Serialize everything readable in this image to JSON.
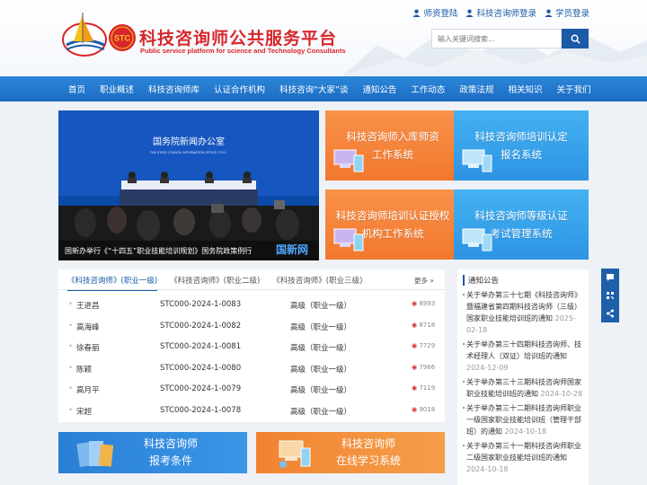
{
  "header": {
    "title": "科技咨询师公共服务平台",
    "subtitle": "Public service platform for science and Technology Consultants",
    "logo_badge": "STC",
    "top_links": [
      "师资登陆",
      "科技咨询师登录",
      "学员登录"
    ],
    "search_placeholder": "输入关键词搜索..."
  },
  "nav": {
    "items": [
      "首页",
      "职业概述",
      "科技咨询师库",
      "认证合作机构",
      "科技咨询“大家”谈",
      "通知公告",
      "工作动态",
      "政策法规",
      "相关知识",
      "关于我们"
    ]
  },
  "banner": {
    "screen_text": "国务院新闻办公室",
    "screen_subtext": "THE STATE COUNCIL INFORMATION OFFICE, P.R.C.",
    "caption": "国新办举行《“十四五”职业技能培训规划》国务院政策例行",
    "watermark": "国新网"
  },
  "tiles": [
    {
      "line1": "科技咨询师入库师资",
      "line2": "工作系统"
    },
    {
      "line1": "科技咨询师培训认定",
      "line2": "报名系统"
    },
    {
      "line1": "科技咨询师培训认证授权",
      "line2": "机构工作系统"
    },
    {
      "line1": "科技咨询师等级认证",
      "line2": "考试管理系统"
    }
  ],
  "consultants": {
    "tabs": [
      "《科技咨询师》(职业一级)",
      "《科技咨询师》(职业二级)",
      "《科技咨询师》(职业三级)"
    ],
    "more": "更多 »",
    "rows": [
      {
        "name": "王进昌",
        "code": "STC000-2024-1-0083",
        "level": "高级（职业一级）",
        "views": "8993"
      },
      {
        "name": "高海峰",
        "code": "STC000-2024-1-0082",
        "level": "高级（职业一级）",
        "views": "8718"
      },
      {
        "name": "徐春丽",
        "code": "STC000-2024-1-0081",
        "level": "高级（职业一级）",
        "views": "7729"
      },
      {
        "name": "陈颖",
        "code": "STC000-2024-1-0080",
        "level": "高级（职业一级）",
        "views": "7966"
      },
      {
        "name": "高月平",
        "code": "STC000-2024-1-0079",
        "level": "高级（职业一级）",
        "views": "7119"
      },
      {
        "name": "宋超",
        "code": "STC000-2024-1-0078",
        "level": "高级（职业一级）",
        "views": "9018"
      }
    ]
  },
  "notice": {
    "title": "通知公告",
    "items": [
      {
        "text": "关于举办第三十七期《科技咨询师》暨福建省第四期科技咨询师（三级）国家职业技能培训班的通知",
        "date": "2025-02-18"
      },
      {
        "text": "关于举办第三十四期科技咨询师、技术经理人（双证）培训班的通知",
        "date": "2024-12-09"
      },
      {
        "text": "关于举办第三十三期科技咨询师国家职业技能培训班的通知",
        "date": "2024-10-28"
      },
      {
        "text": "关于举办第三十二期科技咨询师职业一级国家职业技能培训班（管理干部班）的通知",
        "date": "2024-10-18"
      },
      {
        "text": "关于举办第三十一期科技咨询师职业二级国家职业技能培训班的通知",
        "date": "2024-10-18"
      }
    ]
  },
  "bottom_banners": [
    {
      "line1": "科技咨询师",
      "line2": "报考条件"
    },
    {
      "line1": "科技咨询师",
      "line2": "在线学习系统"
    }
  ],
  "colors": {
    "brand_red": "#d8262b",
    "brand_blue": "#1a5aa6",
    "tile_orange": "#f2772e",
    "tile_blue": "#2d93e3"
  }
}
